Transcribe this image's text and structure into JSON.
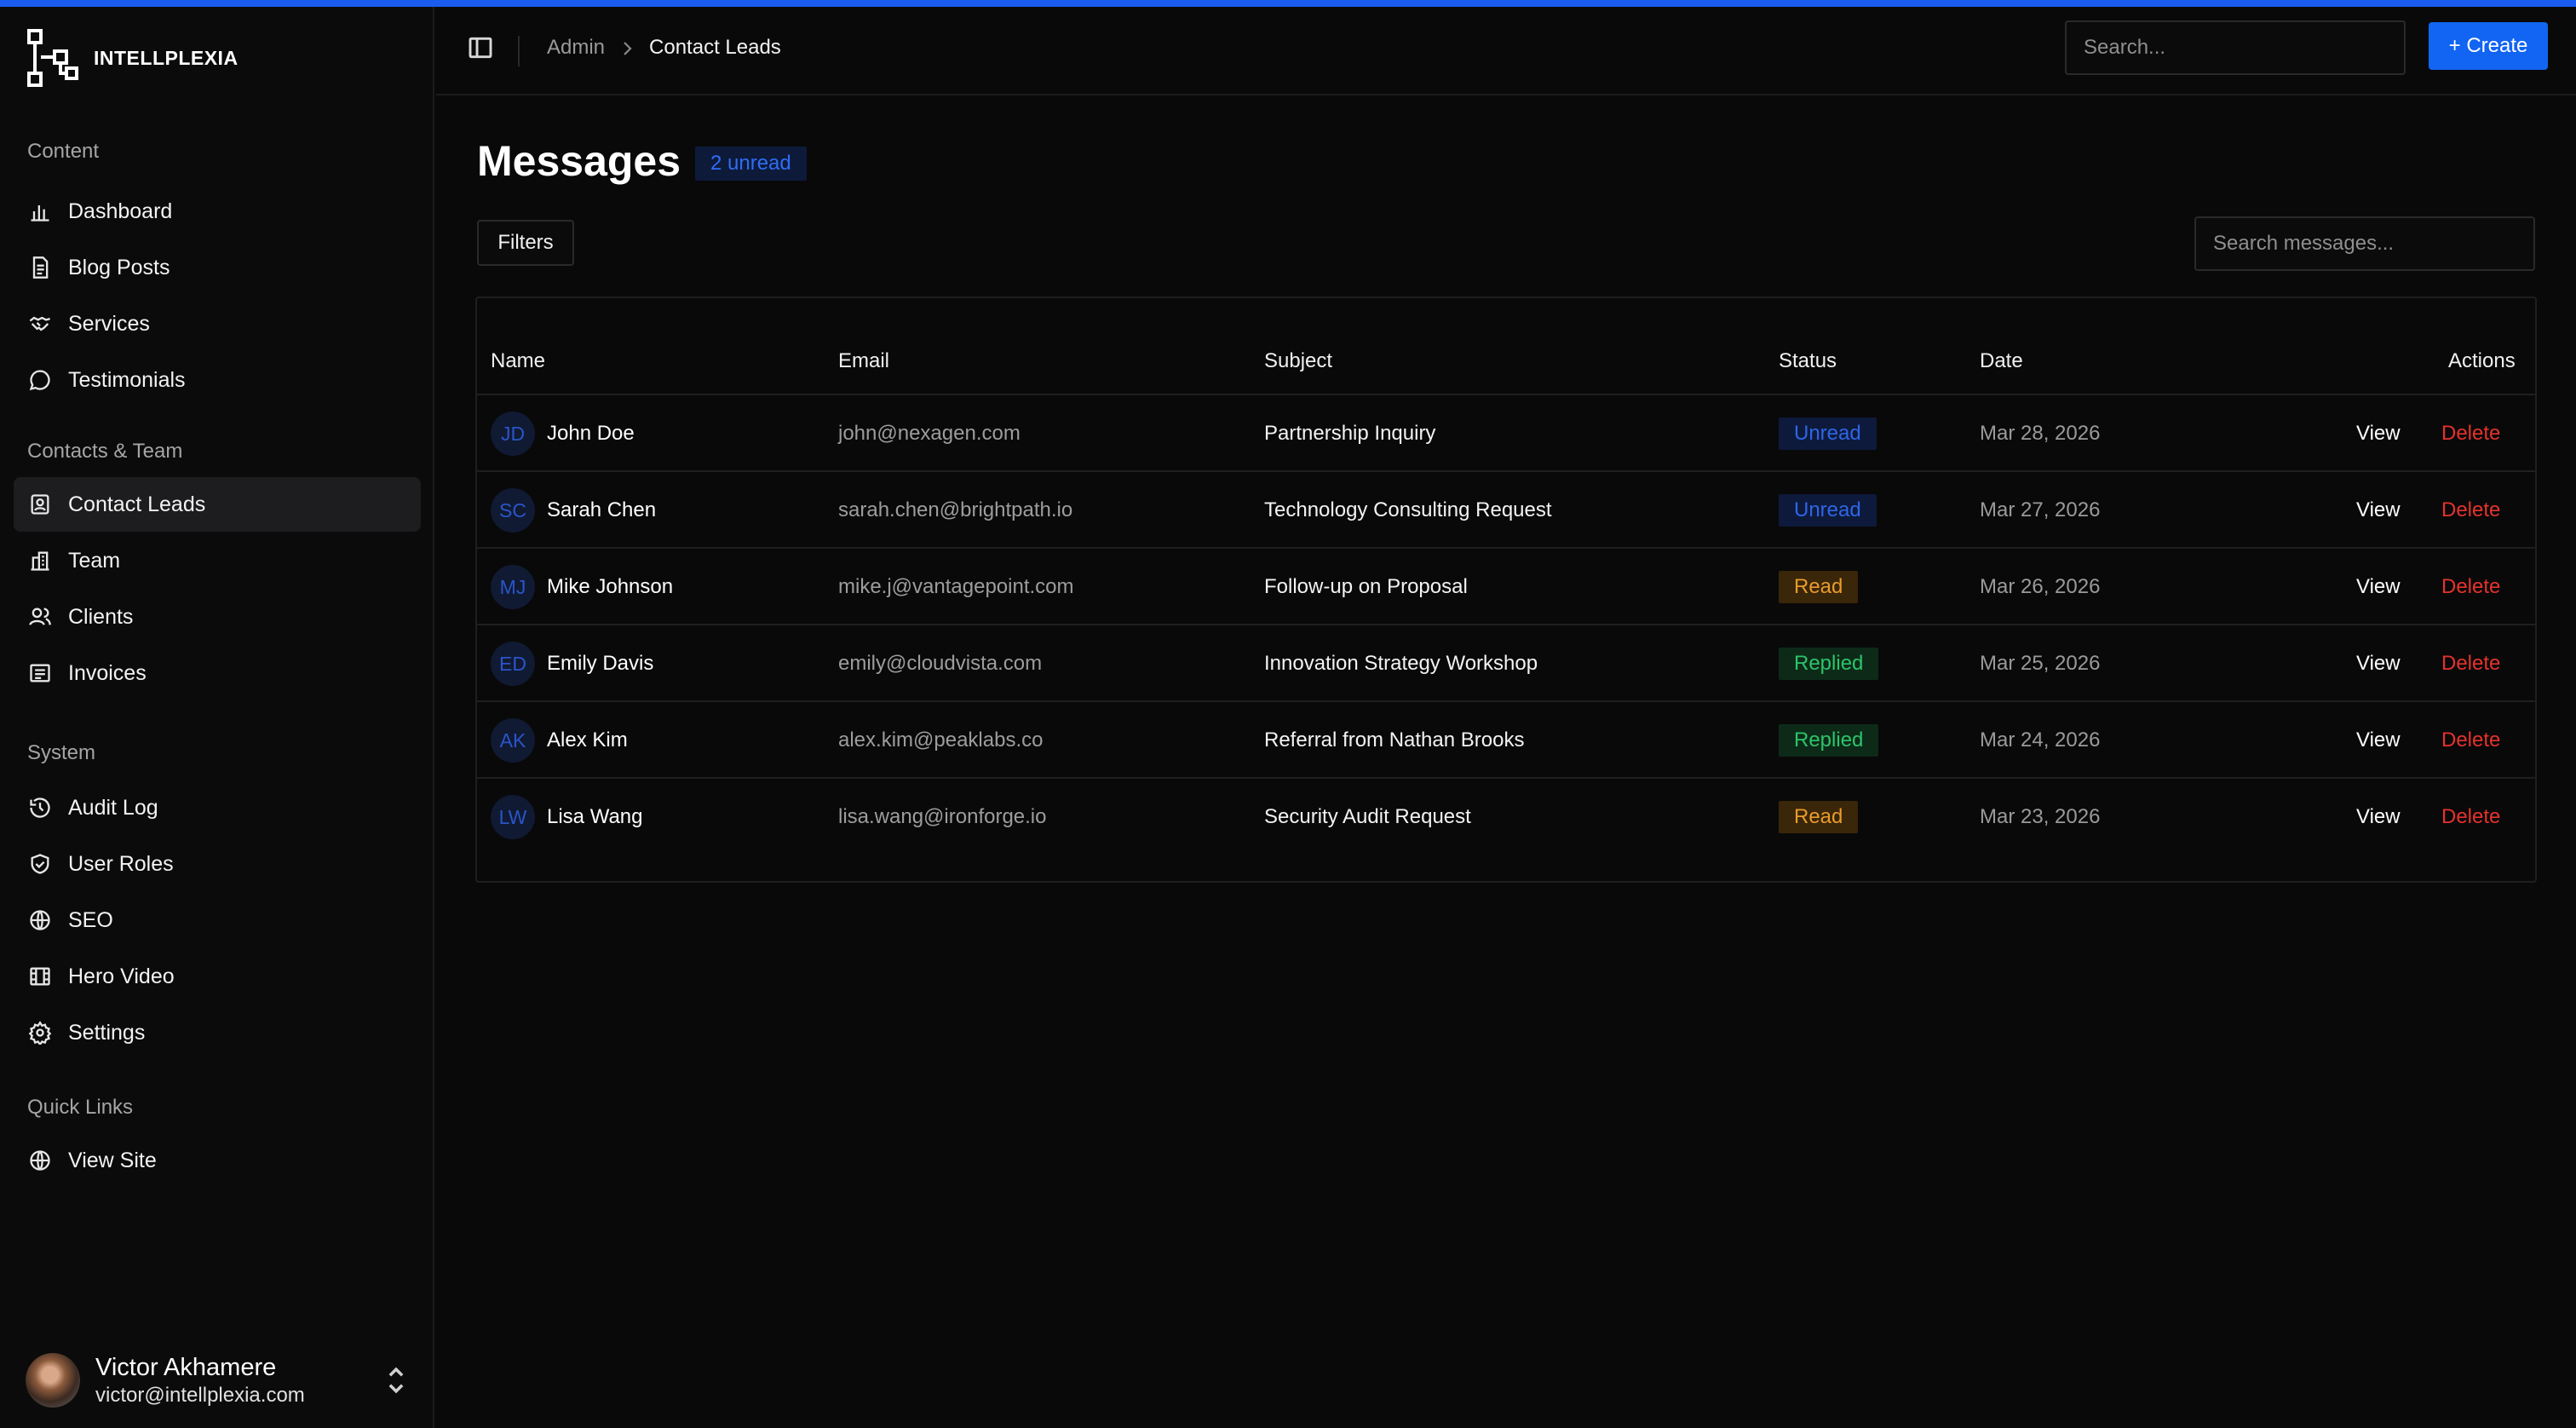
{
  "brand": {
    "name": "INTELLPLEXIA"
  },
  "sidebar": {
    "sections": [
      {
        "title": "Content",
        "items": [
          {
            "label": "Dashboard",
            "icon": "bar-chart-icon"
          },
          {
            "label": "Blog Posts",
            "icon": "document-icon"
          },
          {
            "label": "Services",
            "icon": "handshake-icon"
          },
          {
            "label": "Testimonials",
            "icon": "message-circle-icon"
          }
        ]
      },
      {
        "title": "Contacts & Team",
        "items": [
          {
            "label": "Contact Leads",
            "icon": "contact-card-icon",
            "active": true
          },
          {
            "label": "Team",
            "icon": "building-icon"
          },
          {
            "label": "Clients",
            "icon": "users-icon"
          },
          {
            "label": "Invoices",
            "icon": "receipt-icon"
          }
        ]
      },
      {
        "title": "System",
        "items": [
          {
            "label": "Audit Log",
            "icon": "history-icon"
          },
          {
            "label": "User Roles",
            "icon": "shield-check-icon"
          },
          {
            "label": "SEO",
            "icon": "globe-icon"
          },
          {
            "label": "Hero Video",
            "icon": "film-icon"
          },
          {
            "label": "Settings",
            "icon": "gear-icon"
          }
        ]
      },
      {
        "title": "Quick Links",
        "items": [
          {
            "label": "View Site",
            "icon": "globe-icon"
          }
        ]
      }
    ],
    "user": {
      "name": "Victor Akhamere",
      "email": "victor@intellplexia.com"
    }
  },
  "header": {
    "breadcrumb": {
      "root": "Admin",
      "current": "Contact Leads"
    },
    "search_placeholder": "Search...",
    "create_label": "+ Create"
  },
  "main": {
    "title": "Messages",
    "unread_badge": "2 unread",
    "filters_label": "Filters",
    "search_placeholder": "Search messages...",
    "columns": {
      "name": "Name",
      "email": "Email",
      "subject": "Subject",
      "status": "Status",
      "date": "Date",
      "actions": "Actions"
    },
    "actions": {
      "view": "View",
      "delete": "Delete"
    },
    "rows": [
      {
        "initials": "JD",
        "name": "John Doe",
        "email": "john@nexagen.com",
        "subject": "Partnership Inquiry",
        "status": "Unread",
        "date": "Mar 28, 2026"
      },
      {
        "initials": "SC",
        "name": "Sarah Chen",
        "email": "sarah.chen@brightpath.io",
        "subject": "Technology Consulting Request",
        "status": "Unread",
        "date": "Mar 27, 2026"
      },
      {
        "initials": "MJ",
        "name": "Mike Johnson",
        "email": "mike.j@vantagepoint.com",
        "subject": "Follow-up on Proposal",
        "status": "Read",
        "date": "Mar 26, 2026"
      },
      {
        "initials": "ED",
        "name": "Emily Davis",
        "email": "emily@cloudvista.com",
        "subject": "Innovation Strategy Workshop",
        "status": "Replied",
        "date": "Mar 25, 2026"
      },
      {
        "initials": "AK",
        "name": "Alex Kim",
        "email": "alex.kim@peaklabs.co",
        "subject": "Referral from Nathan Brooks",
        "status": "Replied",
        "date": "Mar 24, 2026"
      },
      {
        "initials": "LW",
        "name": "Lisa Wang",
        "email": "lisa.wang@ironforge.io",
        "subject": "Security Audit Request",
        "status": "Read",
        "date": "Mar 23, 2026"
      }
    ]
  },
  "colors": {
    "accent": "#1264f2",
    "status_unread_bg": "#0e1a3b",
    "status_unread_fg": "#2e66e8",
    "status_read_bg": "#3a2608",
    "status_read_fg": "#e89b2c",
    "status_replied_bg": "#0d2a18",
    "status_replied_fg": "#2cc46a",
    "delete": "#e5322d"
  }
}
